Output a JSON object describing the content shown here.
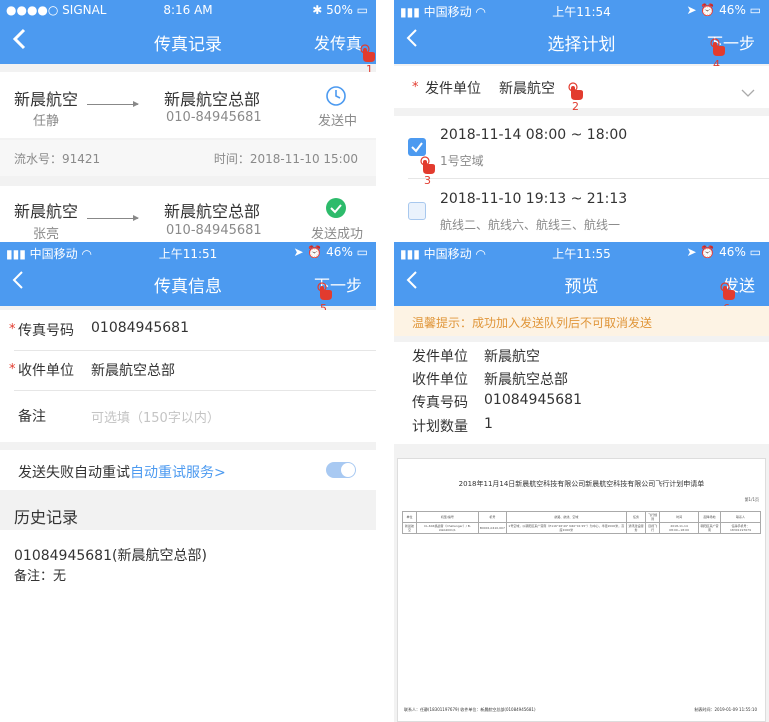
{
  "panel1": {
    "status": {
      "carrier": "●●●●○ SIGNAL",
      "time": "8:16 AM",
      "battery": "50%"
    },
    "title": "传真记录",
    "right_action": "发传真",
    "tap_number": "1",
    "records": [
      {
        "from": "新晨航空",
        "from_person": "任静",
        "to": "新晨航空总部",
        "to_number": "010-84945681",
        "status": "发送中",
        "serial_label": "流水号：91421",
        "time_label": "时间：2018-11-10 15:00"
      },
      {
        "from": "新晨航空",
        "from_person": "张亮",
        "to": "新晨航空总部",
        "to_number": "010-84945681",
        "status": "发送成功"
      }
    ]
  },
  "panel2": {
    "status": {
      "carrier": "中国移动",
      "time": "上午11:54",
      "battery": "46%"
    },
    "title": "选择计划",
    "right_action": "下一步",
    "sender_label": "发件单位",
    "sender_value": "新晨航空",
    "plans": [
      {
        "time": "2018-11-14 08:00 ~ 18:00",
        "desc": "1号空域",
        "checked": true
      },
      {
        "time": "2018-11-10 19:13 ~ 21:13",
        "desc": "航线二、航线六、航线三、航线一",
        "checked": false
      }
    ],
    "taps": [
      "2",
      "3",
      "4"
    ]
  },
  "panel3": {
    "status": {
      "carrier": "中国移动",
      "time": "上午11:51",
      "battery": "46%"
    },
    "title": "传真信息",
    "right_action": "下一步",
    "tap_number": "5",
    "fax_label": "传真号码",
    "fax_value": "01084945681",
    "receiver_label": "收件单位",
    "receiver_value": "新晨航空总部",
    "remark_label": "备注",
    "remark_placeholder": "可选填（150字以内）",
    "retry_label": "发送失败自动重试",
    "retry_link": "自动重试服务>",
    "history_title": "历史记录",
    "history_entry": "01084945681(新晨航空总部)",
    "history_remark": "备注：无"
  },
  "panel4": {
    "status": {
      "carrier": "中国移动",
      "time": "上午11:55",
      "battery": "46%"
    },
    "title": "预览",
    "right_action": "发送",
    "tap_number": "6",
    "tip": "温馨提示：成功加入发送队列后不可取消发送",
    "rows": [
      {
        "label": "发件单位",
        "value": "新晨航空"
      },
      {
        "label": "收件单位",
        "value": "新晨航空总部"
      },
      {
        "label": "传真号码",
        "value": "01084945681"
      },
      {
        "label": "计划数量",
        "value": "1"
      }
    ],
    "doc": {
      "title": "2018年11月14日新晨航空科技有限公司新晨航空科技有限公司飞行计划申请单",
      "page": "第1/1页",
      "headers": [
        "单位",
        "机型/编号",
        "机号",
        "航路、航线、空域",
        "任务",
        "飞行规则",
        "时间",
        "起降场地",
        "联系人"
      ],
      "row": [
        "新晨航空",
        "CL-604挑战者（Challenger）/ B-LWA4001/1",
        "B0001,0410,007",
        "1号空域，以朝阳区来广营南（E116°26'49\" N40°01'25\"）为中心，半径2000米，高度2000米",
        "通讯建设服务",
        "目视飞行",
        "2018-11-14 08:00~18:00",
        "朝阳区来广营南",
        "任静手机号：18301197679"
      ],
      "footer_left": "联系人：任静(18301197679) 收件单位：新晨航空总部(01084945681)",
      "footer_right": "制表时间：2019-01-09 11:55:10"
    }
  },
  "colors": {
    "primary": "#4c9af0",
    "success": "#2dbb6b",
    "danger": "#e23b2e",
    "tip_bg": "#fdf3e4",
    "tip_text": "#e0963a"
  }
}
